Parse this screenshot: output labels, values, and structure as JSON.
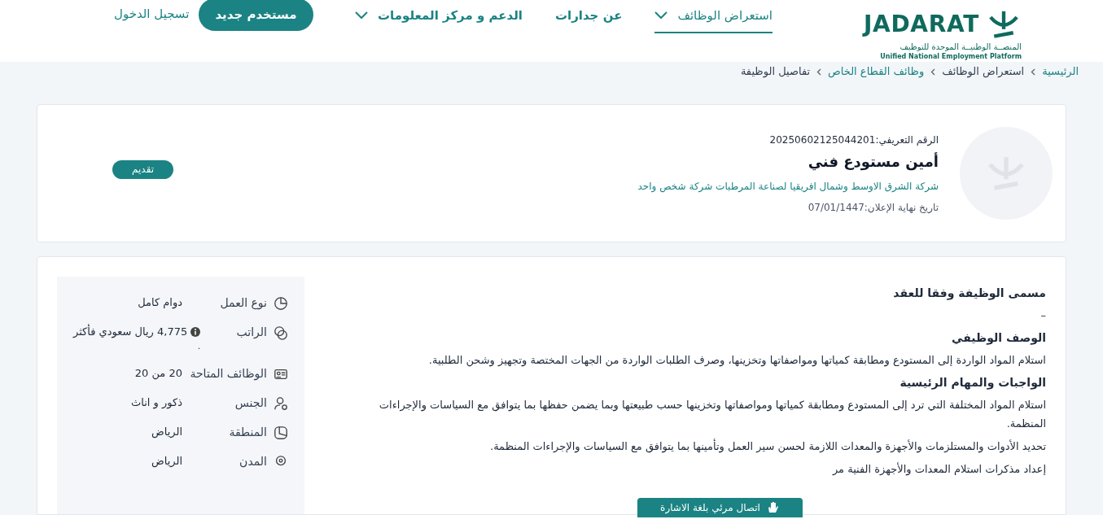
{
  "logo": {
    "name": "JADARAT",
    "subtitle_ar": "المنصــة الوطنيــة الموحدة للتوظيف",
    "subtitle_en": "Unified National Employment Platform"
  },
  "nav": [
    {
      "label": "استعراض الوظائف",
      "dropdown": true,
      "selected": true
    },
    {
      "label": "عن جدارات",
      "dropdown": false,
      "selected": false
    },
    {
      "label": "الدعم و مركز المعلومات",
      "dropdown": true,
      "selected": false
    }
  ],
  "new_user_button": "مستخدم جديد",
  "login_link": "تسجيل الدخول",
  "breadcrumb": [
    {
      "label": "الرئيسية",
      "link": true
    },
    {
      "label": "استعراض الوظائف",
      "link": false
    },
    {
      "label": "وظائف القطاع الخاص",
      "link": true
    },
    {
      "label": "تفاصيل الوظيفة",
      "link": false
    }
  ],
  "job": {
    "id_label": "الرقم التعريفي:",
    "id": "20250602125044201",
    "title": "أمين مستودع فني",
    "company": "شركة الشرق الاوسط وشمال افريقيا لصناعة المرطبات شركة شخص واحد",
    "deadline_label": "تاريخ نهاية الإعلان:",
    "deadline": "07/01/1447",
    "apply_button": "تقديم"
  },
  "details": [
    {
      "kind": "work-type",
      "label": "نوع العمل",
      "value": "دوام كامل"
    },
    {
      "kind": "salary",
      "label": "الراتب",
      "value": "4,775 ريال سعودي فأكثر",
      "note": "."
    },
    {
      "kind": "openings",
      "label": "الوظائف المتاحة",
      "value": "20  من 20"
    },
    {
      "kind": "gender",
      "label": "الجنس",
      "value": "ذكور و اناث"
    },
    {
      "kind": "region",
      "label": "المنطقة",
      "value": "الرياض"
    },
    {
      "kind": "city",
      "label": "المدن",
      "value": "الرياض"
    }
  ],
  "sections": [
    {
      "heading": "مسمى الوظيفة وفقا للعقد",
      "paragraphs": [
        "–"
      ]
    },
    {
      "heading": "الوصف الوظيفي",
      "paragraphs": [
        "استلام المواد الواردة إلى المستودع ومطابقة كمياتها ومواصفاتها وتخزينها، وصرف الطلبات الواردة من الجهات المختصة وتجهيز وشحن الطلبية."
      ]
    },
    {
      "heading": "الواجبات والمهام الرئيسية",
      "paragraphs": [
        "استلام المواد المختلفة التي ترد إلى المستودع ومطابقة كمياتها ومواصفاتها وتخزينها حسب طبيعتها وبما يضمن حفظها بما يتوافق مع السياسات والإجراءات المنظمة.",
        "تحديد الأدوات والمستلزمات والأجهزة والمعدات اللازمة لحسن سير العمل وتأمينها بما يتوافق مع السياسات والإجراءات المنظمة.",
        "إعداد مذكرات استلام المعدات والأجهزة الفنية مر"
      ]
    }
  ],
  "sign_language_button": "اتصال مرئي بلغة الاشارة"
}
